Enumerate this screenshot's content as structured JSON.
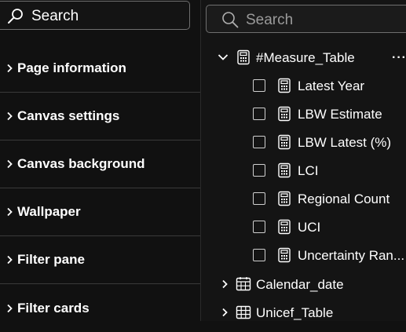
{
  "left_panel": {
    "search_placeholder": "Search",
    "sections": [
      {
        "label": "Page information"
      },
      {
        "label": "Canvas settings"
      },
      {
        "label": "Canvas background"
      },
      {
        "label": "Wallpaper"
      },
      {
        "label": "Filter pane"
      },
      {
        "label": "Filter cards"
      }
    ]
  },
  "right_panel": {
    "search_placeholder": "Search",
    "tables": [
      {
        "name": "#Measure_Table",
        "icon": "calculator-table-icon",
        "expanded": true,
        "measures": [
          {
            "name": "Latest Year"
          },
          {
            "name": "LBW Estimate"
          },
          {
            "name": "LBW Latest (%)"
          },
          {
            "name": "LCI"
          },
          {
            "name": "Regional Count"
          },
          {
            "name": "UCI"
          },
          {
            "name": "Uncertainty Ran..."
          }
        ]
      },
      {
        "name": "Calendar_date",
        "icon": "calendar-table-icon",
        "expanded": false
      },
      {
        "name": "Unicef_Table",
        "icon": "table-icon",
        "expanded": false
      }
    ]
  },
  "colors": {
    "background": "#111111",
    "border": "#6f6f6f",
    "text": "#ffffff",
    "placeholder": "#9a9a9a"
  }
}
